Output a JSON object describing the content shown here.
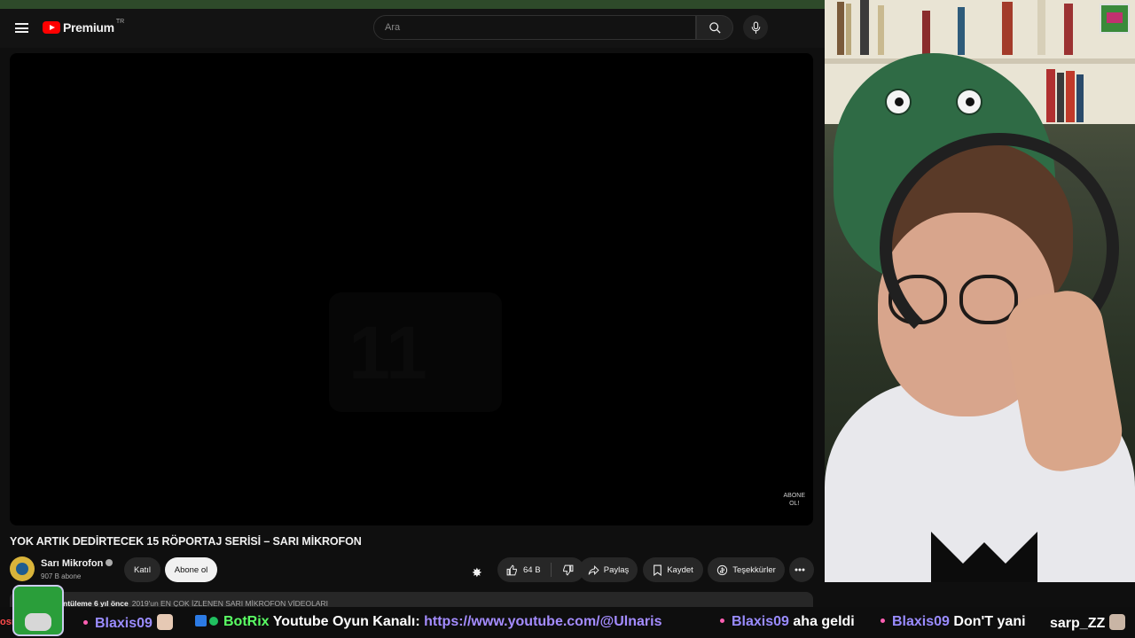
{
  "masthead": {
    "logo_text": "Premium",
    "logo_country": "TR",
    "search_placeholder": "Ara"
  },
  "player": {
    "watermark_line1": "ABONE",
    "watermark_line2": "OL!"
  },
  "video": {
    "title": "YOK ARTIK DEDİRTECEK 15 RÖPORTAJ SERİSİ – SARI MİKROFON"
  },
  "channel": {
    "name": "Sarı Mikrofon",
    "subscribers": "907 B abone"
  },
  "actions": {
    "join_label": "Katıl",
    "subscribe_label": "Abone ol",
    "like_count": "64 B",
    "share_label": "Paylaş",
    "save_label": "Kaydet",
    "thanks_label": "Teşekkürler"
  },
  "description": {
    "views_date": "ntüleme  6 yıl önce",
    "snippet": "2019'un EN ÇOK İZLENEN SARI MİKROFON VİDEOLARI"
  },
  "chat_ticker": [
    {
      "user": "osnail",
      "message": ""
    },
    {
      "user": "Blaxis09",
      "message": ""
    },
    {
      "user": "BotRix",
      "message": "Youtube Oyun Kanalı:",
      "link": "https://www.youtube.com/@Ulnaris"
    },
    {
      "user": "Blaxis09",
      "message": "aha geldi"
    },
    {
      "user": "Blaxis09",
      "message": "Don'T yani"
    },
    {
      "user": "sarp_ZZ",
      "message": ""
    }
  ],
  "colors": {
    "youtube_red": "#ff0000",
    "chat_user": "#9a8cff",
    "bot_user": "#5aff64",
    "link": "#a48cff"
  }
}
